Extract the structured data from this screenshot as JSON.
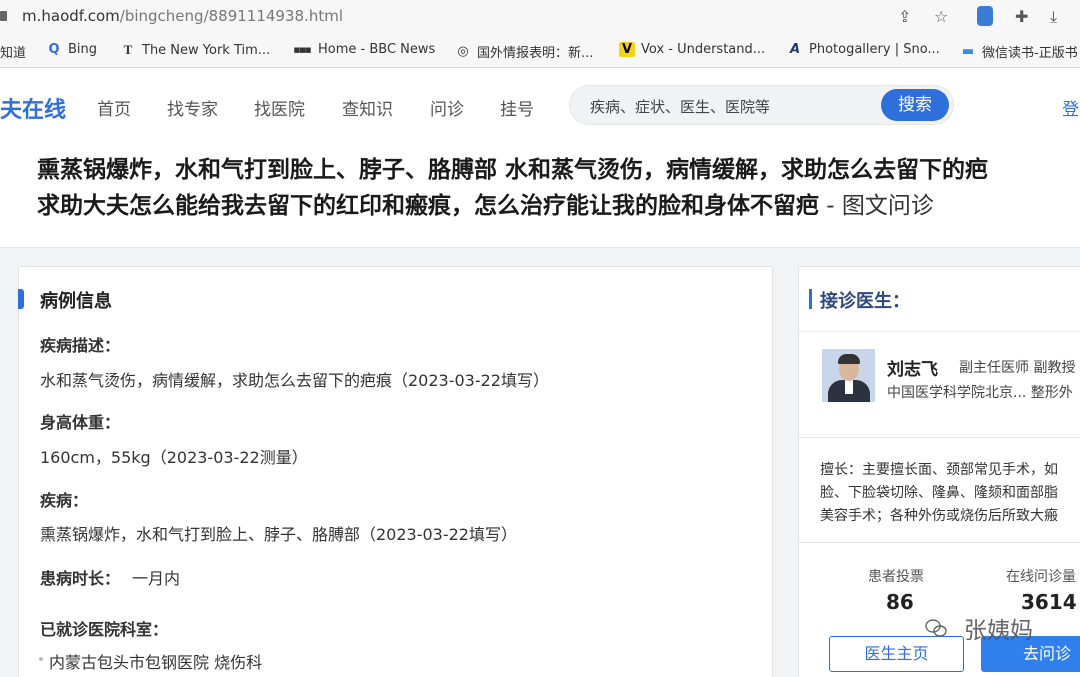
{
  "browser": {
    "url_host": "m.haodf.com",
    "url_path": "/bingcheng/8891114938.html",
    "toolbar_icons": [
      "share-icon",
      "star-icon",
      "extension-icon",
      "puzzle-icon",
      "download-icon"
    ],
    "bookmarks": [
      {
        "icon": "zhidao-icon",
        "glyph": "",
        "label": "知道"
      },
      {
        "icon": "search-icon",
        "glyph": "Q",
        "label": "Bing"
      },
      {
        "icon": "nyt-icon",
        "glyph": "T",
        "label": "The New York Tim..."
      },
      {
        "icon": "bbc-icon",
        "glyph": "■■■",
        "label": "Home - BBC News"
      },
      {
        "icon": "globe-icon",
        "glyph": "◎",
        "label": "国外情报表明：新..."
      },
      {
        "icon": "vox-icon",
        "glyph": "V",
        "label": "Vox - Understand..."
      },
      {
        "icon": "photogallery-icon",
        "glyph": "A",
        "label": "Photogallery | Sno..."
      },
      {
        "icon": "weread-icon",
        "glyph": "▬",
        "label": "微信读书-正版书"
      }
    ]
  },
  "site": {
    "logo": "夫在线",
    "nav": [
      "首页",
      "找专家",
      "找医院",
      "查知识",
      "问诊",
      "挂号"
    ],
    "search_placeholder": "疾病、症状、医生、医院等",
    "search_button": "搜索",
    "login": "登"
  },
  "page": {
    "title_line1": "熏蒸锅爆炸，水和气打到脸上、脖子、胳膊部 水和蒸气烫伤，病情缓解，求助怎么去留下的疤",
    "title_line2_bold": "求助大夫怎么能给我去留下的红印和瘢痕，怎么治疗能让我的脸和身体不留疤",
    "title_line2_suffix": " - 图文问诊"
  },
  "case": {
    "section_title": "病例信息",
    "desc_label": "疾病描述：",
    "desc_value": "水和蒸气烫伤，病情缓解，求助怎么去留下的疤痕（2023-03-22填写）",
    "hw_label": "身高体重：",
    "hw_value": "160cm，55kg（2023-03-22测量）",
    "disease_label": "疾病：",
    "disease_value": "熏蒸锅爆炸，水和气打到脸上、脖子、胳膊部（2023-03-22填写）",
    "duration_label": "患病时长：",
    "duration_value": "一月内",
    "hospital_label": "已就诊医院科室：",
    "hospital_value": "内蒙古包头市包钢医院 烧伤科"
  },
  "doctor": {
    "section_title": "接诊医生：",
    "name": "刘志飞",
    "titles": "副主任医师 副教授",
    "hospital": "中国医学科学院北京... 整形外",
    "skill_line1": "擅长：主要擅长面、颈部常见手术，如",
    "skill_line2": "脸、下脸袋切除、隆鼻、隆颏和面部脂",
    "skill_line3": "美容手术；各种外伤或烧伤后所致大瘢",
    "votes_label": "患者投票",
    "votes_value": "86",
    "consults_label": "在线问诊量",
    "consults_value": "3614",
    "homepage_button": "医生主页",
    "consult_button": "去问诊"
  },
  "watermark": "张姨妈"
}
